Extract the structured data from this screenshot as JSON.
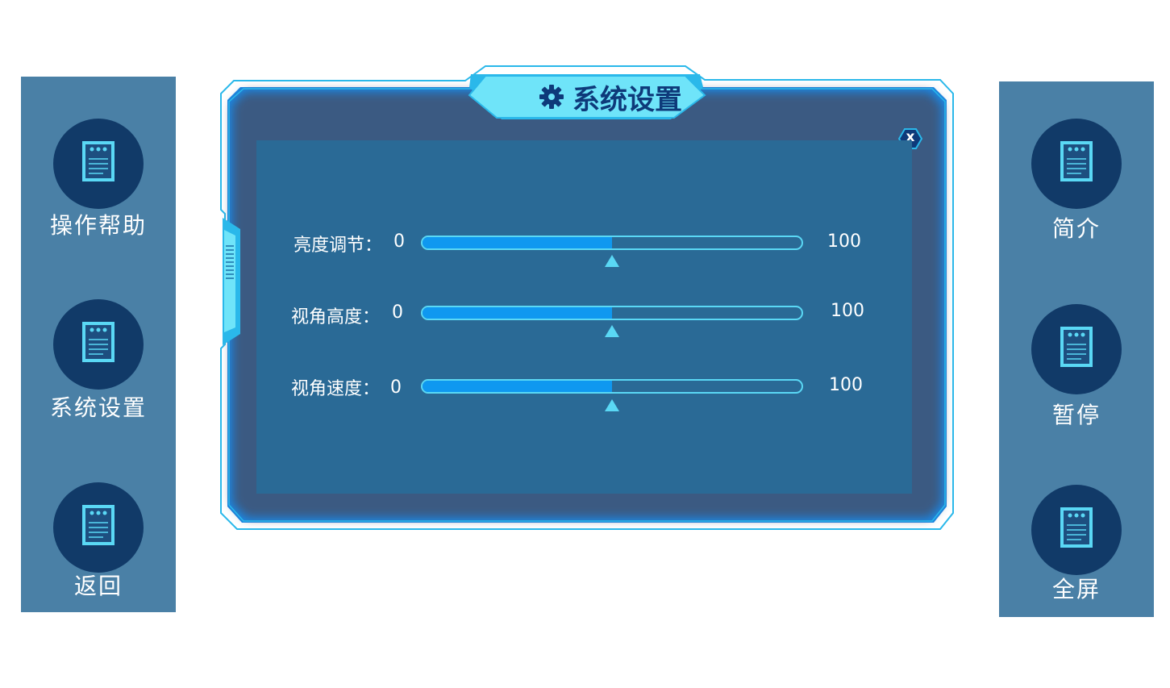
{
  "left_sidebar": {
    "items": [
      {
        "label": "操作帮助",
        "icon": "document-icon"
      },
      {
        "label": "系统设置",
        "icon": "document-icon"
      },
      {
        "label": "返回",
        "icon": "document-icon"
      }
    ]
  },
  "right_sidebar": {
    "items": [
      {
        "label": "简介",
        "icon": "document-icon"
      },
      {
        "label": "暂停",
        "icon": "document-icon"
      },
      {
        "label": "全屏",
        "icon": "document-icon"
      }
    ]
  },
  "dialog": {
    "title": "系统设置",
    "title_icon": "gear-icon",
    "close_label": "x",
    "sliders": [
      {
        "label": "亮度调节：",
        "min": "0",
        "max": "100",
        "value": 50
      },
      {
        "label": "视角高度：",
        "min": "0",
        "max": "100",
        "value": 50
      },
      {
        "label": "视角速度：",
        "min": "0",
        "max": "100",
        "value": 50
      }
    ]
  },
  "colors": {
    "sidebar_bg": "#4a80a6",
    "button_circle": "#113a68",
    "dialog_bg": "#2a6a96",
    "accent": "#5ad8f5",
    "slider_fill": "#0f98f0"
  }
}
